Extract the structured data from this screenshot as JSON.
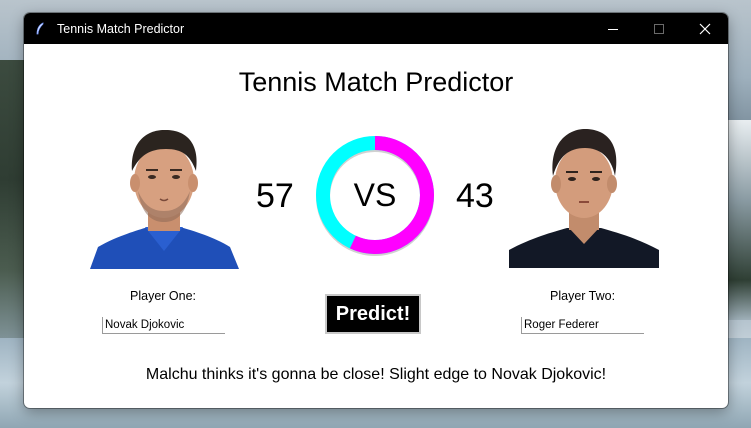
{
  "window": {
    "title": "Tennis Match Predictor"
  },
  "app": {
    "heading": "Tennis Match Predictor",
    "vs_text": "VS",
    "predict_label": "Predict!",
    "message": "Malchu thinks it's gonna be close! Slight edge to Novak Djokovic!"
  },
  "player_one": {
    "label": "Player One:",
    "name": "Novak Djokovic",
    "score": "57",
    "color": "#ff00ff"
  },
  "player_two": {
    "label": "Player Two:",
    "name": "Roger Federer",
    "score": "43",
    "color": "#00ffff"
  },
  "prediction": {
    "player_one_fraction": 0.57,
    "player_two_fraction": 0.43
  },
  "colors": {
    "titlebar": "#000000",
    "button_bg": "#000000",
    "button_text": "#ffffff"
  }
}
